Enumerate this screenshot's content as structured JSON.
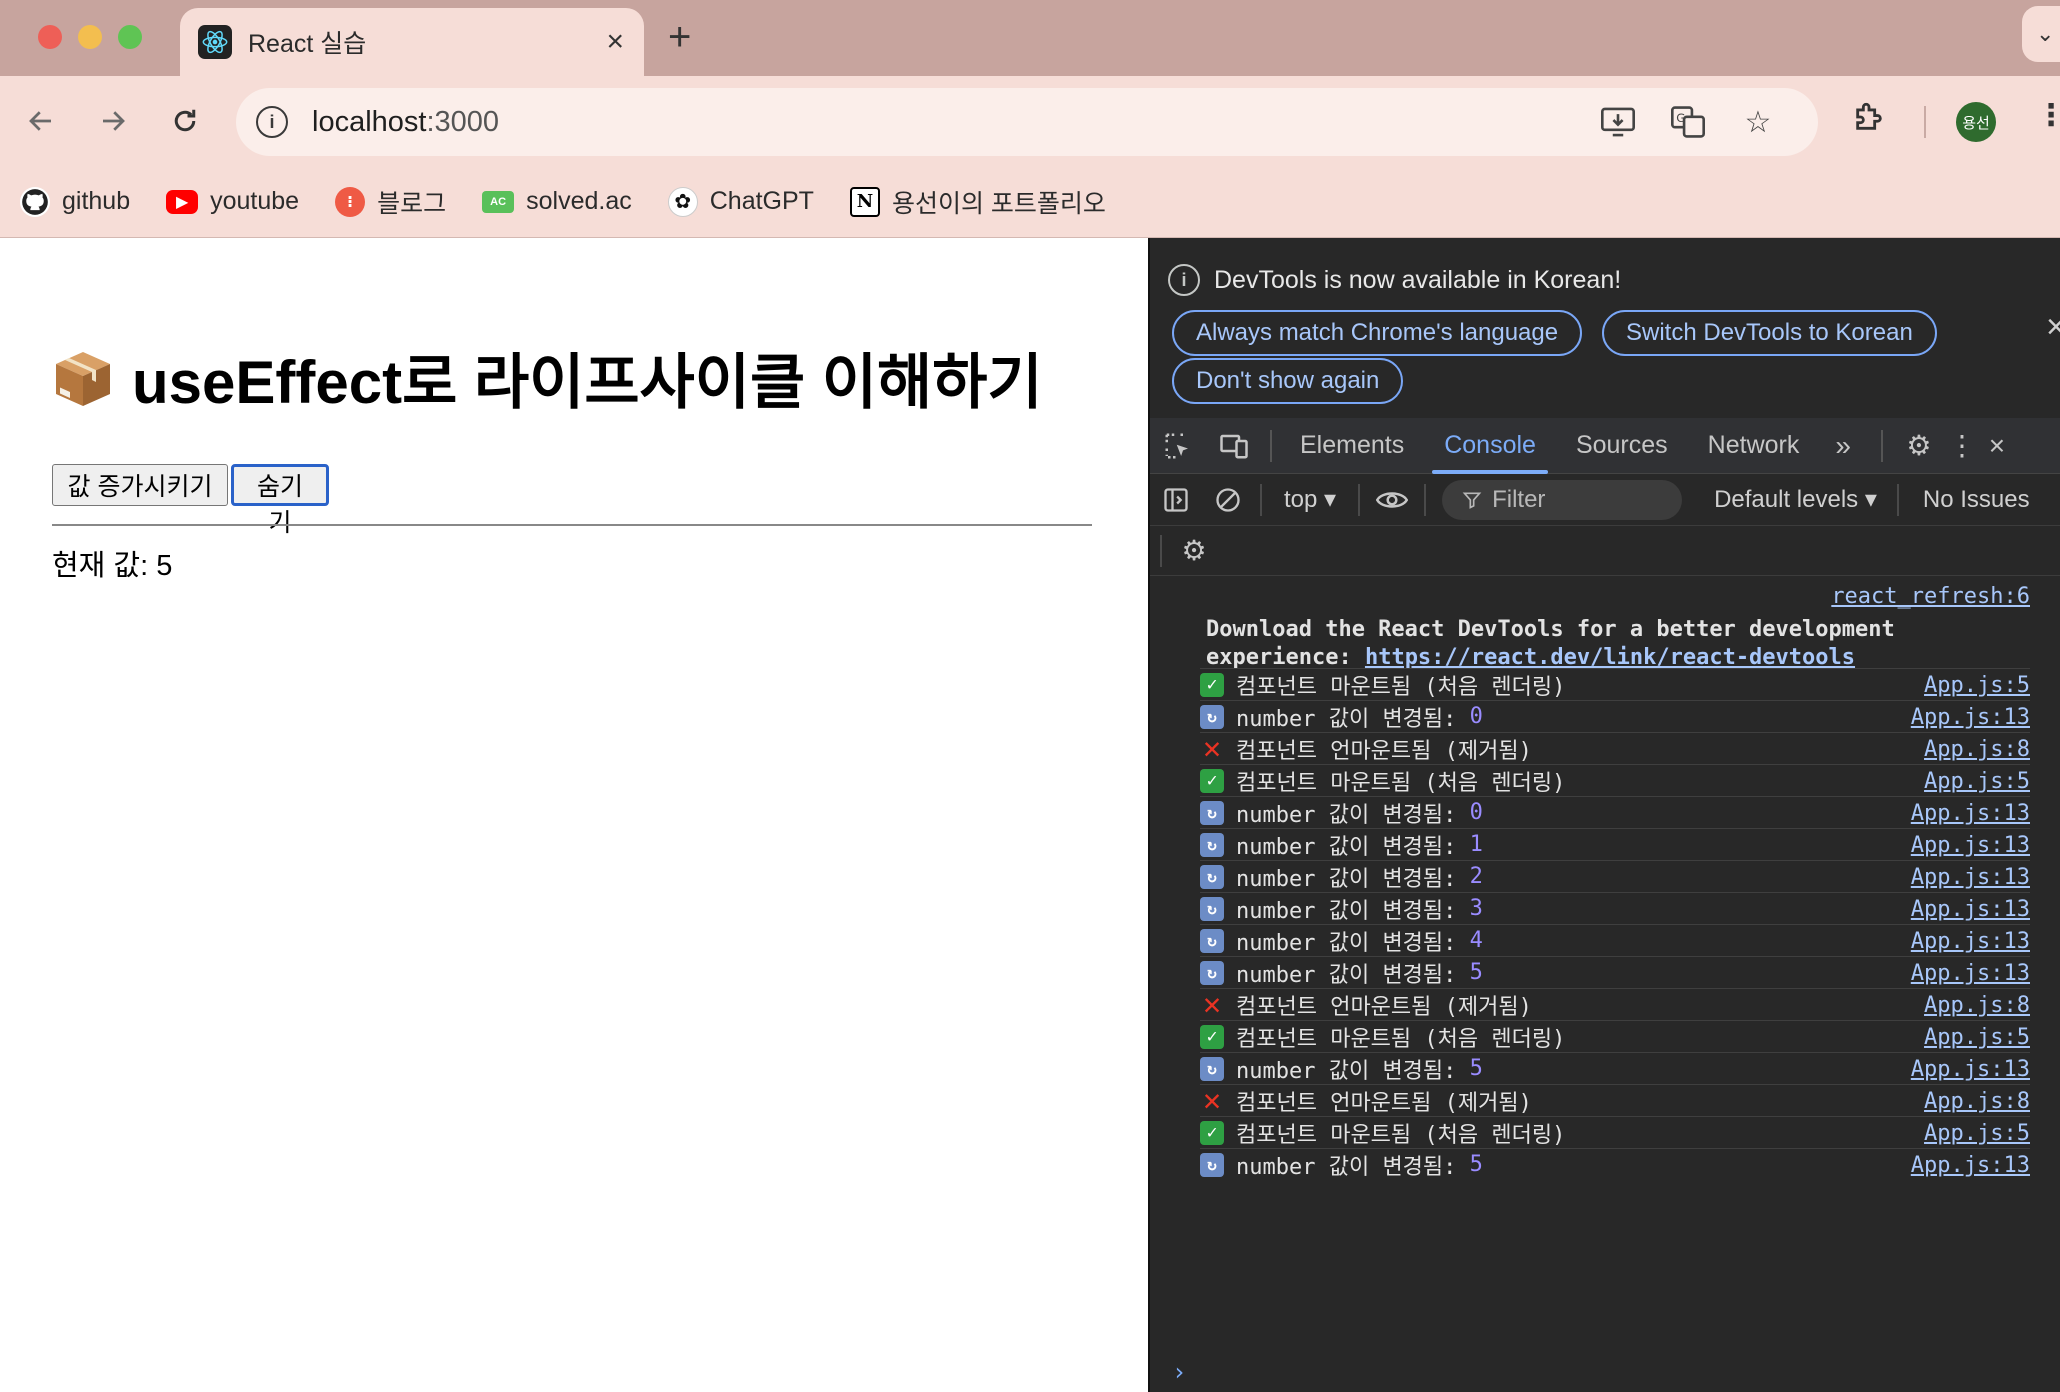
{
  "browser": {
    "tab": {
      "title": "React 실습",
      "close": "×"
    },
    "new_tab": "+",
    "tab_search": "⌄",
    "url": {
      "host": "localhost",
      "port": ":3000"
    },
    "avatar": "용선",
    "bookmarks": [
      {
        "label": "github",
        "icon": "github-icon"
      },
      {
        "label": "youtube",
        "icon": "youtube-icon"
      },
      {
        "label": "블로그",
        "icon": "blog-icon"
      },
      {
        "label": "solved.ac",
        "icon": "solvedac-icon"
      },
      {
        "label": "ChatGPT",
        "icon": "chatgpt-icon"
      },
      {
        "label": "용선이의 포트폴리오",
        "icon": "notion-icon"
      }
    ]
  },
  "page": {
    "title": "useEffect로 라이프사이클 이해하기",
    "increment_button": "값 증가시키기",
    "hide_button": "숨기기",
    "current_value": "현재 값: 5"
  },
  "devtools": {
    "notice": {
      "message": "DevTools is now available in Korean!",
      "always_match": "Always match Chrome's language",
      "switch": "Switch DevTools to Korean",
      "dont_show": "Don't show again"
    },
    "tabs": [
      "Elements",
      "Console",
      "Sources",
      "Network"
    ],
    "active_tab": "Console",
    "console_bar": {
      "context": "top ▾",
      "filter_placeholder": "Filter",
      "levels": "Default levels ▾",
      "issues": "No Issues"
    },
    "react_devtools": {
      "source": "react_refresh:6",
      "line1": "Download the React DevTools for a better development",
      "line2_prefix": "experience: ",
      "link": "https://react.dev/link/react-devtools"
    },
    "logs": [
      {
        "type": "mount",
        "text": "컴포넌트 마운트됨 (처음 렌더링)",
        "value": "",
        "source": "App.js:5"
      },
      {
        "type": "update",
        "text": "number 값이 변경됨: ",
        "value": "0",
        "source": "App.js:13"
      },
      {
        "type": "unmount",
        "text": "컴포넌트 언마운트됨 (제거됨)",
        "value": "",
        "source": "App.js:8"
      },
      {
        "type": "mount",
        "text": "컴포넌트 마운트됨 (처음 렌더링)",
        "value": "",
        "source": "App.js:5"
      },
      {
        "type": "update",
        "text": "number 값이 변경됨: ",
        "value": "0",
        "source": "App.js:13"
      },
      {
        "type": "update",
        "text": "number 값이 변경됨: ",
        "value": "1",
        "source": "App.js:13"
      },
      {
        "type": "update",
        "text": "number 값이 변경됨: ",
        "value": "2",
        "source": "App.js:13"
      },
      {
        "type": "update",
        "text": "number 값이 변경됨: ",
        "value": "3",
        "source": "App.js:13"
      },
      {
        "type": "update",
        "text": "number 값이 변경됨: ",
        "value": "4",
        "source": "App.js:13"
      },
      {
        "type": "update",
        "text": "number 값이 변경됨: ",
        "value": "5",
        "source": "App.js:13"
      },
      {
        "type": "unmount",
        "text": "컴포넌트 언마운트됨 (제거됨)",
        "value": "",
        "source": "App.js:8"
      },
      {
        "type": "mount",
        "text": "컴포넌트 마운트됨 (처음 렌더링)",
        "value": "",
        "source": "App.js:5"
      },
      {
        "type": "update",
        "text": "number 값이 변경됨: ",
        "value": "5",
        "source": "App.js:13"
      },
      {
        "type": "unmount",
        "text": "컴포넌트 언마운트됨 (제거됨)",
        "value": "",
        "source": "App.js:8"
      },
      {
        "type": "mount",
        "text": "컴포넌트 마운트됨 (처음 렌더링)",
        "value": "",
        "source": "App.js:5"
      },
      {
        "type": "update",
        "text": "number 값이 변경됨: ",
        "value": "5",
        "source": "App.js:13"
      }
    ],
    "prompt": "›"
  },
  "colors": {
    "tabstrip": "#c7a49e",
    "toolbar": "#f6ddd7",
    "devtools_bg": "#282828",
    "accent": "#7cacf8"
  }
}
